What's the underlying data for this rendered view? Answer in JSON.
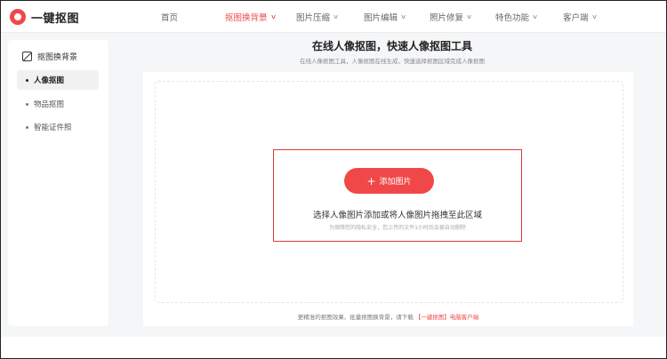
{
  "header": {
    "logo_text": "一键抠图",
    "nav": [
      {
        "label": "首页",
        "chevron": false,
        "active": false
      },
      {
        "label": "抠图换背景",
        "chevron": true,
        "active": true
      },
      {
        "label": "图片压缩",
        "chevron": true,
        "active": false
      },
      {
        "label": "图片编辑",
        "chevron": true,
        "active": false
      },
      {
        "label": "照片修复",
        "chevron": true,
        "active": false
      },
      {
        "label": "特色功能",
        "chevron": true,
        "active": false
      },
      {
        "label": "客户端",
        "chevron": true,
        "active": false
      }
    ]
  },
  "sidebar": {
    "title": "抠图换背景",
    "items": [
      {
        "label": "人像抠图",
        "active": true
      },
      {
        "label": "物品抠图",
        "active": false
      },
      {
        "label": "智能证件照",
        "active": false
      }
    ]
  },
  "main": {
    "title": "在线人像抠图，快速人像抠图工具",
    "subtitle": "在线人像抠图工具，人像抠图在线生成，快速选择抠图区域完成人像抠图",
    "add_button_label": "添加图片",
    "drop_text": "选择人像图片添加或将人像图片拖拽至此区域",
    "privacy_text": "为保障您的隐私安全，您上传的文件1小时后会被自动删除",
    "footer_prefix": "更精准的抠图效果、批量抠图换背景，请下载",
    "footer_link": "【一键抠图】电脑客户端"
  },
  "colors": {
    "accent": "#f04848",
    "highlight_box": "#e03a3a"
  }
}
